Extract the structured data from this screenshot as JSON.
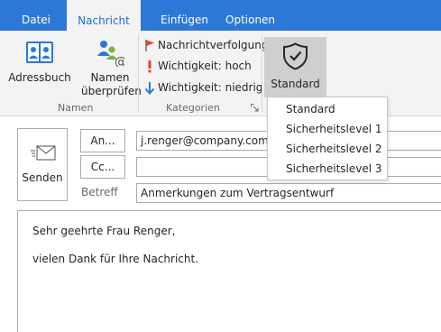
{
  "tabs": [
    {
      "label": "Datei",
      "active": false
    },
    {
      "label": "Nachricht",
      "active": true
    },
    {
      "label": "Einfügen",
      "active": false
    },
    {
      "label": "Optionen",
      "active": false
    }
  ],
  "ribbon": {
    "names_group": {
      "label": "Namen",
      "address_book": "Adressbuch",
      "check_names_line1": "Namen",
      "check_names_line2": "überprüfen"
    },
    "categories_group": {
      "label": "Kategorien",
      "items": [
        {
          "label": "Nachrichtverfolgung",
          "icon": "flag-icon"
        },
        {
          "label": "Wichtigkeit: hoch",
          "icon": "exclamation-icon"
        },
        {
          "label": "Wichtigkeit: niedrig",
          "icon": "arrow-down-icon"
        }
      ]
    },
    "security": {
      "label": "Standard",
      "icon": "shield-check-icon",
      "options": [
        "Standard",
        "Sicherheitslevel 1",
        "Sicherheitslevel 2",
        "Sicherheitslevel 3"
      ]
    }
  },
  "compose": {
    "send_label": "Senden",
    "to_button": "An...",
    "cc_button": "Cc...",
    "to_value": "j.renger@company.com",
    "cc_value": "",
    "subject_label": "Betreff",
    "subject_value": "Anmerkungen zum Vertragsentwurf"
  },
  "message_body": {
    "greeting": "Sehr geehrte Frau Renger,",
    "line1": "vielen Dank für Ihre Nachricht."
  },
  "colors": {
    "accent": "#2b78d6",
    "ribbon_bg": "#f3f3f3",
    "flag": "#e8402f",
    "arrow": "#2b78d6",
    "selected_button": "#cfcfcf"
  }
}
